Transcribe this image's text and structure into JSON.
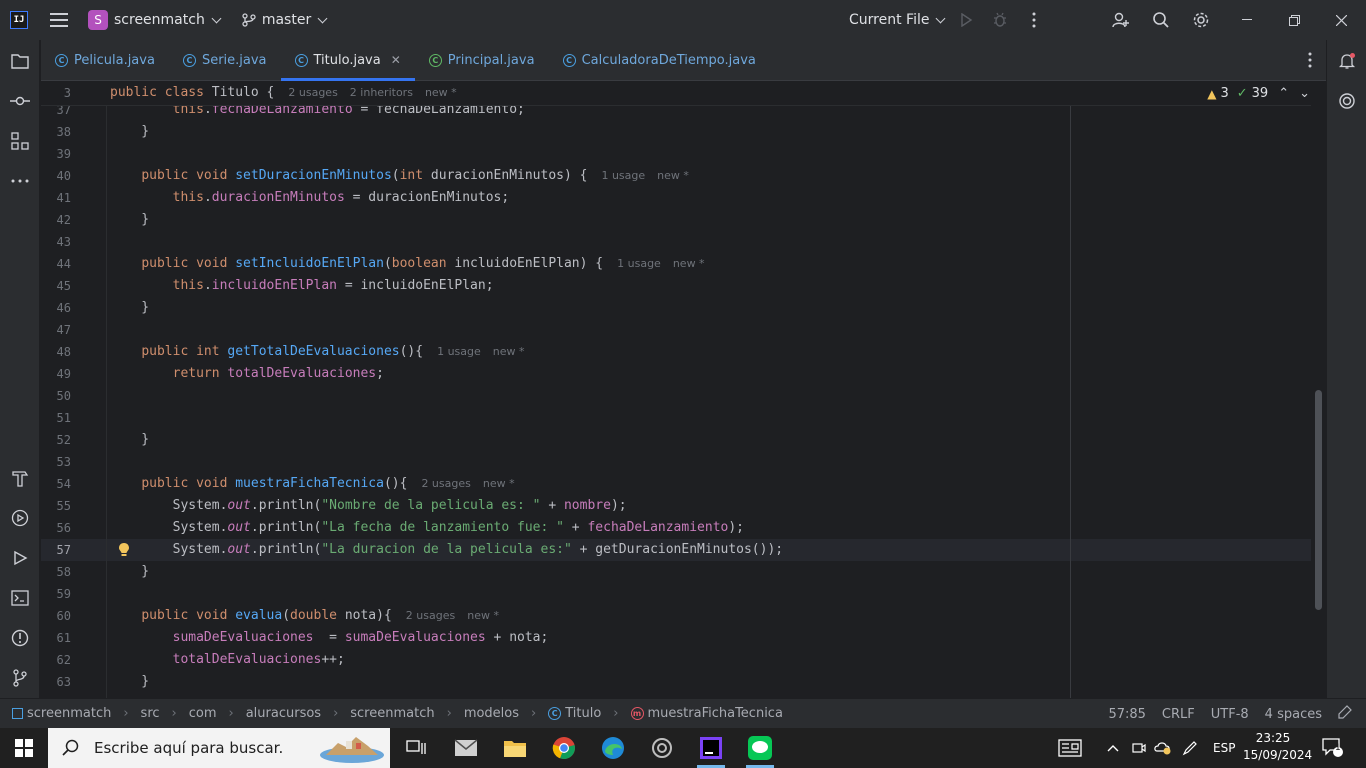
{
  "titlebar": {
    "app_logo_text": "IJ",
    "project_initial": "S",
    "project_name": "screenmatch",
    "branch": "master",
    "run_config": "Current File"
  },
  "tabs": [
    {
      "label": "Pelicula.java"
    },
    {
      "label": "Serie.java"
    },
    {
      "label": "Titulo.java",
      "active": true
    },
    {
      "label": "Principal.java"
    },
    {
      "label": "CalculadoraDeTiempo.java"
    }
  ],
  "editor": {
    "sticky": {
      "line": "3",
      "hint1": "2 usages",
      "hint2": "2 inheritors",
      "hint3": "new *"
    },
    "inspections": {
      "warnings": "3",
      "ok": "39"
    },
    "line_numbers": [
      "37",
      "38",
      "39",
      "40",
      "41",
      "42",
      "43",
      "44",
      "45",
      "46",
      "47",
      "48",
      "49",
      "50",
      "51",
      "52",
      "53",
      "54",
      "55",
      "56",
      "57",
      "58",
      "59",
      "60",
      "61",
      "62",
      "63"
    ],
    "hints": {
      "l40_usage": "1 usage",
      "l40_new": "new *",
      "l44_usage": "1 usage",
      "l44_new": "new *",
      "l48_usage": "1 usage",
      "l48_new": "new *",
      "l54_usage": "2 usages",
      "l54_new": "new *",
      "l60_usage": "2 usages",
      "l60_new": "new *"
    },
    "cursor_line": "57"
  },
  "statusbar": {
    "breadcrumbs": [
      "screenmatch",
      "src",
      "com",
      "aluracursos",
      "screenmatch",
      "modelos",
      "Titulo",
      "muestraFichaTecnica"
    ],
    "position": "57:85",
    "line_sep": "CRLF",
    "encoding": "UTF-8",
    "indent": "4 spaces"
  },
  "taskbar": {
    "search_placeholder": "Escribe aquí para buscar.",
    "lang": "ESP",
    "time": "23:25",
    "date": "15/09/2024",
    "notif_count": "1"
  },
  "colors": {
    "keyword": "#cf8e6d",
    "function": "#56a8f5",
    "field": "#c77dbb",
    "string": "#6aab73",
    "accent": "#3574f0",
    "editor_bg": "#1e1f22",
    "panel_bg": "#2b2d30"
  }
}
